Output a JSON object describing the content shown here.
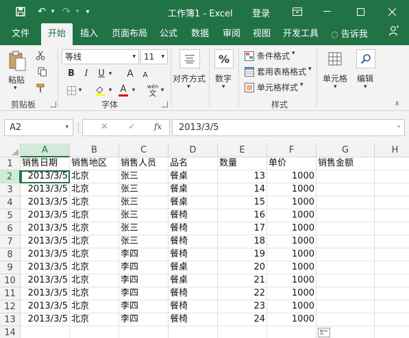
{
  "titlebar": {
    "title": "工作簿1 - Excel",
    "login": "登录",
    "save_icon": "💾",
    "undo_icon": "↶",
    "redo_icon": "↷",
    "customize_icon": "▾",
    "ribbon_display_icon": "▣",
    "minimize_icon": "—",
    "maximize_icon": "☐",
    "close_icon": "✕"
  },
  "tabs": [
    "文件",
    "开始",
    "插入",
    "页面布局",
    "公式",
    "数据",
    "审阅",
    "视图",
    "开发工具",
    "告诉我"
  ],
  "tell_me_icon": "💡",
  "share_icon": "♙",
  "ribbon": {
    "clipboard": {
      "paste": "粘贴",
      "group": "剪贴板"
    },
    "font": {
      "name": "等线",
      "size": "11",
      "bold": "B",
      "italic": "I",
      "underline": "U",
      "grow": "A",
      "shrink": "A",
      "wen": "wén",
      "group": "字体"
    },
    "align": {
      "label": "对齐方式"
    },
    "number": {
      "label": "数字",
      "symbol": "%"
    },
    "styles": {
      "conditional": "条件格式",
      "table": "套用表格格式",
      "cell": "单元格样式",
      "group": "样式"
    },
    "cells": {
      "label": "单元格"
    },
    "edit": {
      "label": "编辑"
    }
  },
  "formula_bar": {
    "namebox": "A2",
    "fx": "fx",
    "cancel": "✕",
    "enter": "✓",
    "value": "2013/3/5"
  },
  "columns": [
    "A",
    "B",
    "C",
    "D",
    "E",
    "F",
    "G",
    "H"
  ],
  "rows": [
    "1",
    "2",
    "3",
    "4",
    "5",
    "6",
    "7",
    "8",
    "9",
    "10",
    "11",
    "12",
    "13",
    "14"
  ],
  "headers": [
    "销售日期",
    "销售地区",
    "销售人员",
    "品名",
    "数量",
    "单价",
    "销售金额"
  ],
  "table": [
    [
      "2013/3/5",
      "北京",
      "张三",
      "餐桌",
      "13",
      "1000"
    ],
    [
      "2013/3/5",
      "北京",
      "张三",
      "餐桌",
      "14",
      "1000"
    ],
    [
      "2013/3/5",
      "北京",
      "张三",
      "餐桌",
      "15",
      "1000"
    ],
    [
      "2013/3/5",
      "北京",
      "张三",
      "餐椅",
      "16",
      "1000"
    ],
    [
      "2013/3/5",
      "北京",
      "张三",
      "餐椅",
      "17",
      "1000"
    ],
    [
      "2013/3/5",
      "北京",
      "张三",
      "餐椅",
      "18",
      "1000"
    ],
    [
      "2013/3/5",
      "北京",
      "李四",
      "餐椅",
      "19",
      "1000"
    ],
    [
      "2013/3/5",
      "北京",
      "李四",
      "餐桌",
      "20",
      "1000"
    ],
    [
      "2013/3/5",
      "北京",
      "李四",
      "餐桌",
      "21",
      "1000"
    ],
    [
      "2013/3/5",
      "北京",
      "李四",
      "餐椅",
      "22",
      "1000"
    ],
    [
      "2013/3/5",
      "北京",
      "李四",
      "餐椅",
      "23",
      "1000"
    ],
    [
      "2013/3/5",
      "北京",
      "李四",
      "餐椅",
      "24",
      "1000"
    ]
  ],
  "selected_cell": "A2",
  "colors": {
    "brand": "#217346",
    "selection": "#d3e9d9"
  }
}
